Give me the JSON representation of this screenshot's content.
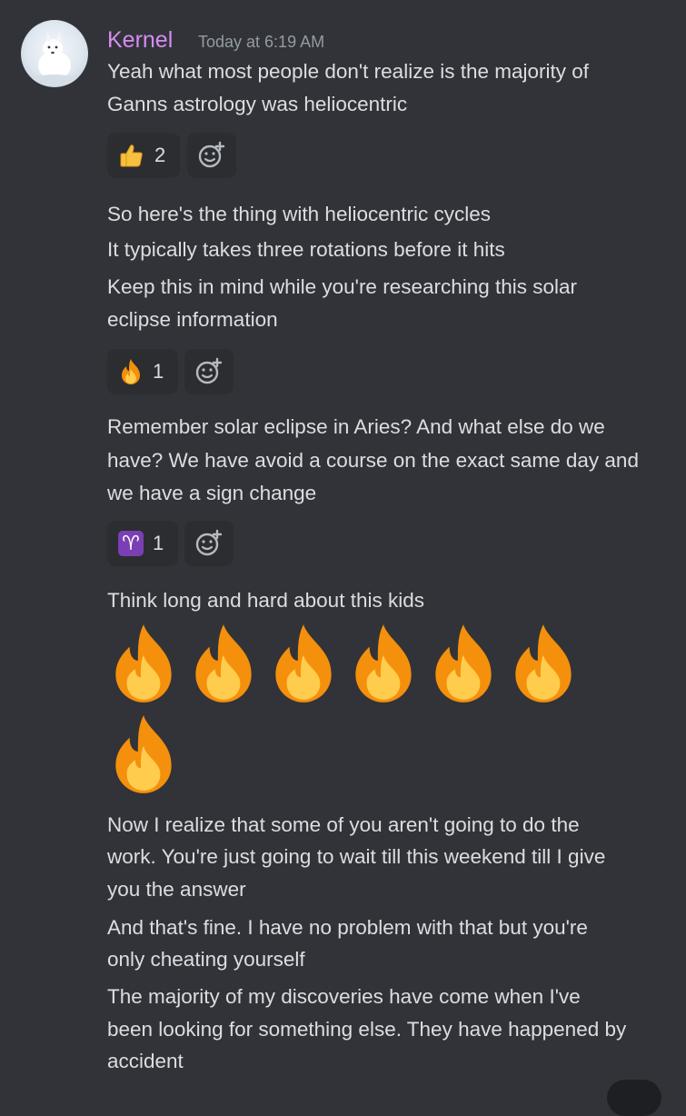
{
  "message": {
    "author": "Kernel",
    "timestamp": "Today at 6:19 AM",
    "author_color": "#d68cf2",
    "avatar_icon": "arctic-fox-avatar"
  },
  "lines": {
    "l1": "Yeah what most people don't realize is the majority of",
    "l2": "Ganns  astrology was heliocentric",
    "l3": "So here's the thing with heliocentric cycles",
    "l4": "It typically takes three rotations before it hits",
    "l5": "Keep this in mind while you're researching this solar",
    "l6": "eclipse information",
    "l7": "Remember solar eclipse in Aries? And what else do we",
    "l8": "have? We have avoid a course on the exact same day and",
    "l9": "we have a sign change",
    "l10": "Think long and hard about this kids",
    "l11": "Now I realize that some of you aren't going to do the",
    "l12": "work. You're just going to wait till this weekend till I give",
    "l13": "you the answer",
    "l14": "And that's fine. I have no problem with that but you're",
    "l15": "only cheating yourself",
    "l16": "The majority of my discoveries have come when I've",
    "l17": "been looking for something else. They have happened by",
    "l18": "accident"
  },
  "reactions": {
    "r1": {
      "emoji": "thumbs-up-icon",
      "count": "2"
    },
    "r2": {
      "emoji": "fire-icon",
      "count": "1"
    },
    "r3": {
      "emoji": "aries-icon",
      "glyph": "♈",
      "count": "1"
    }
  },
  "fire_emoji_count": 7,
  "colors": {
    "background": "#313338",
    "text": "#dbdee1",
    "muted": "#949ba4",
    "reaction_bg": "#2b2d31"
  }
}
